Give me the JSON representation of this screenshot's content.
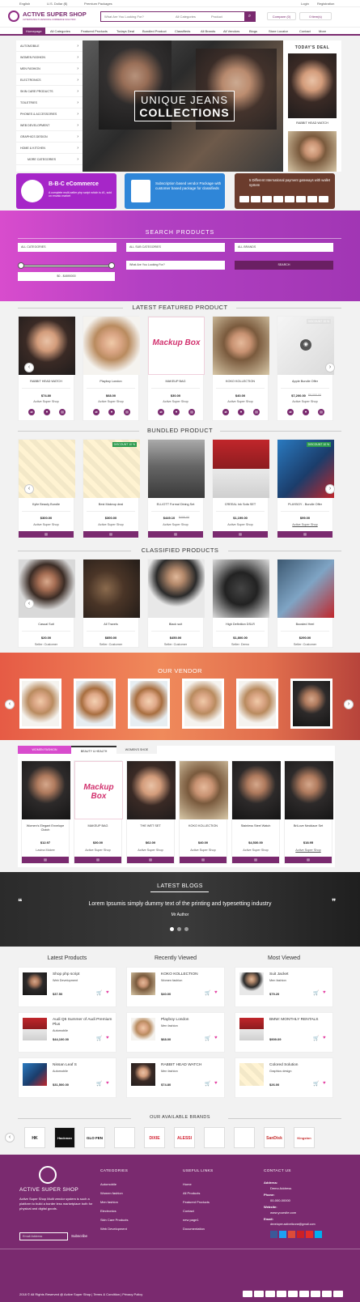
{
  "topbar": {
    "language": "English",
    "currency": "U.S. Dollar ($)",
    "premium": "Premium Packages",
    "login": "Login",
    "register": "Registration"
  },
  "header": {
    "logo_title": "ACTIVE SUPER SHOP",
    "logo_sub": "ULTIMATE MULTI-VENDOR E-COMMERCE SOLUTION",
    "search_placeholder": "What Are You Looking For?",
    "category_select": "All Categories",
    "type_select": "Product",
    "compare": "Compare (0)",
    "cart": "0 item(s)"
  },
  "nav": [
    "Homepage",
    "All Categories",
    "Featured Products",
    "Todays Deal",
    "Bundled Product",
    "Classifieds",
    "All Brands",
    "All Vendors",
    "Blogs",
    "Store Locator",
    "Contact",
    "More"
  ],
  "categories": [
    "AUTOMOBILE",
    "WOMEN FASHION",
    "MEN FASHION",
    "ELECTRONICS",
    "SKIN CARE PRODUCTS",
    "TOILETRIES",
    "PHONES & ACCESSORIES",
    "WEB DEVELOPMENT",
    "GRAPHICS DESIGN",
    "HOME & KITCHEN",
    "MORE CATEGORIES"
  ],
  "hero": {
    "line1": "UNIQUE JEANS",
    "line2": "COLLECTIONS"
  },
  "todays_deal": {
    "title": "TODAY'S DEAL",
    "item": "RABBIT HEAD WATCH"
  },
  "banners": [
    {
      "title": "B-B-C eCommerce",
      "text": "A complete multi-seller php script which is #1, sold on envato market",
      "color": "#a626c8"
    },
    {
      "text": "Subscription based vendor Package with customer based package for classifieds",
      "color": "#2f86d8"
    },
    {
      "text": "5 Different International payment gateways with wallet system",
      "color": "#6b3c2d"
    }
  ],
  "search_products": {
    "title": "SEARCH PRODUCTS",
    "cat": "ALL CATEGORIES",
    "subcat": "ALL SUB CATEGORIES",
    "brand": "ALL BRANDS",
    "range": "$0 - $4890000",
    "placeholder": "What Are You Looking For?",
    "button": "SEARCH"
  },
  "latest_featured": {
    "title": "LATEST FEATURED PRODUCT",
    "items": [
      {
        "name": "RABBIT HEAD WATCH",
        "price": "$74.80",
        "shop": "Active Super Shop"
      },
      {
        "name": "Playboy London",
        "price": "$68.00",
        "shop": "Active Super Shop"
      },
      {
        "name": "MAKEUP BAG",
        "price": "$30.00",
        "shop": "Active Super Shop"
      },
      {
        "name": "KOKO KOLLECTION",
        "price": "$40.00",
        "shop": "Active Super Shop"
      },
      {
        "name": "Apple Bundle Offer",
        "price": "$7,200.00",
        "old": "$8,000.00",
        "shop": "Active Super Shop",
        "badge": "DISCOUNT 10 %"
      }
    ]
  },
  "bundled": {
    "title": "BUNDLED PRODUCT",
    "items": [
      {
        "name": "Kylie Beauty Bundle",
        "price": "$300.00",
        "shop": "Active Super Shop"
      },
      {
        "name": "Best Makeup deal",
        "price": "$300.00",
        "shop": "Active Super Shop",
        "badge": "DISCOUNT 10 %"
      },
      {
        "name": "ELLIOTT Formal Dining Set",
        "price": "$449.10",
        "old": "$499.00",
        "shop": "Active Super Shop"
      },
      {
        "name": "CREEAL Ink Sofa SET",
        "price": "$1,199.00",
        "shop": "Active Super Shop"
      },
      {
        "name": "PLAYBOY - Bundle Offer",
        "price": "$99.00",
        "shop": "Active Super Shop",
        "badge": "DISCOUNT 10 %"
      }
    ]
  },
  "classified": {
    "title": "CLASSIFIED PRODUCTS",
    "items": [
      {
        "name": "Casual Suit",
        "price": "$20.00",
        "seller": "Seller: Customer"
      },
      {
        "name": "All Travels",
        "price": "$850.00",
        "seller": "Seller: Customer"
      },
      {
        "name": "Black suit",
        "price": "$450.00",
        "seller": "Seller: Customer"
      },
      {
        "name": "High Definition DSLR",
        "price": "$1,800.00",
        "seller": "Seller: Demo"
      },
      {
        "name": "Boosted Heel",
        "price": "$290.00",
        "seller": "Seller: Customer"
      }
    ]
  },
  "vendor": {
    "title": "OUR VENDOR"
  },
  "tabs": {
    "labels": [
      "WOMEN FASHION",
      "BEAUTY & HEALTH",
      "WOMEN'S SHOE"
    ],
    "items": [
      {
        "name": "Women's Elegant Envelope Clutch",
        "price": "$12.97",
        "shop": "Lavina Mckee"
      },
      {
        "name": "MAKEUP BAG",
        "price": "$30.00",
        "shop": "Active Super Shop"
      },
      {
        "name": "THE WET SET",
        "price": "$62.00",
        "shop": "Active Super Shop"
      },
      {
        "name": "KOKO KOLLECTION",
        "price": "$40.00",
        "shop": "Active Super Shop"
      },
      {
        "name": "Stainless Steel Watch",
        "price": "$4,530.00",
        "shop": "Active Super Shop"
      },
      {
        "name": "BriLove Necklace Set",
        "price": "$18.95",
        "shop": "Active Super Shop"
      }
    ]
  },
  "blogs": {
    "title": "LATEST BLOGS",
    "text": "Lorem Ipsumis simply dummy text of the printing and typesetting industry",
    "author": "Mr Author"
  },
  "latest_products": {
    "title": "Latest Products",
    "items": [
      {
        "name": "Shop php script",
        "cat": "Web Development",
        "price": "$37.50"
      },
      {
        "name": "Audi Q5 Summer of Audi Premium Plus",
        "cat": "Automobile",
        "price": "$44,100.00"
      },
      {
        "name": "Nissan Leaf S",
        "cat": "Automobile",
        "price": "$31,500.00"
      }
    ]
  },
  "recently_viewed": {
    "title": "Recently Viewed",
    "items": [
      {
        "name": "KOKO KOLLECTION",
        "cat": "Women fashion",
        "price": "$40.00"
      },
      {
        "name": "Playboy London",
        "cat": "Men fashion",
        "price": "$68.00"
      },
      {
        "name": "RABBIT HEAD WATCH",
        "cat": "Men fashion",
        "price": "$74.80"
      }
    ]
  },
  "most_viewed": {
    "title": "Most Viewed",
    "items": [
      {
        "name": "Suit Jacket",
        "cat": "Men fashion",
        "price": "$79.20"
      },
      {
        "name": "BMW: MONTHLY RENTALS",
        "cat": "",
        "price": "$909.09"
      },
      {
        "name": "Colored Solution",
        "cat": "Graphics design",
        "price": "$26.00"
      }
    ]
  },
  "brands": {
    "title": "OUR AVAILABLE BRANDS",
    "items": [
      "HK",
      "Hackman",
      "GLO FEN",
      "",
      "DIXIE",
      "ALESSI",
      "",
      "",
      "SanDisk",
      "Kingston"
    ]
  },
  "footer": {
    "logo": "ACTIVE SUPER SHOP",
    "about": "Active Super Shop Multi vendor system is such a platform to build a border less marketplace both for physical and digital goods.",
    "email_placeholder": "Email Address",
    "subscribe": "Subscribe",
    "categories_title": "CATEGORIES",
    "categories": [
      "Automobile",
      "Women fashion",
      "Men fashion",
      "Electronics",
      "Skin Care Products",
      "Web Development"
    ],
    "links_title": "USEFUL LINKS",
    "links": [
      "Home",
      "All Products",
      "Featured Products",
      "Contact",
      "new page1",
      "Documentation"
    ],
    "contact_title": "CONTACT US",
    "address_label": "Address:",
    "address": "Demo Address",
    "phone_label": "Phone:",
    "phone": "00-000-00000",
    "website_label": "Website:",
    "website": "www.yoursite.com",
    "email_label": "Email:",
    "email": "developer.activeitzone@gmail.com",
    "copyright": "2018 © All Rights Reserved @ Active Super Shop | Terms & Condition | Privacy Policy"
  }
}
